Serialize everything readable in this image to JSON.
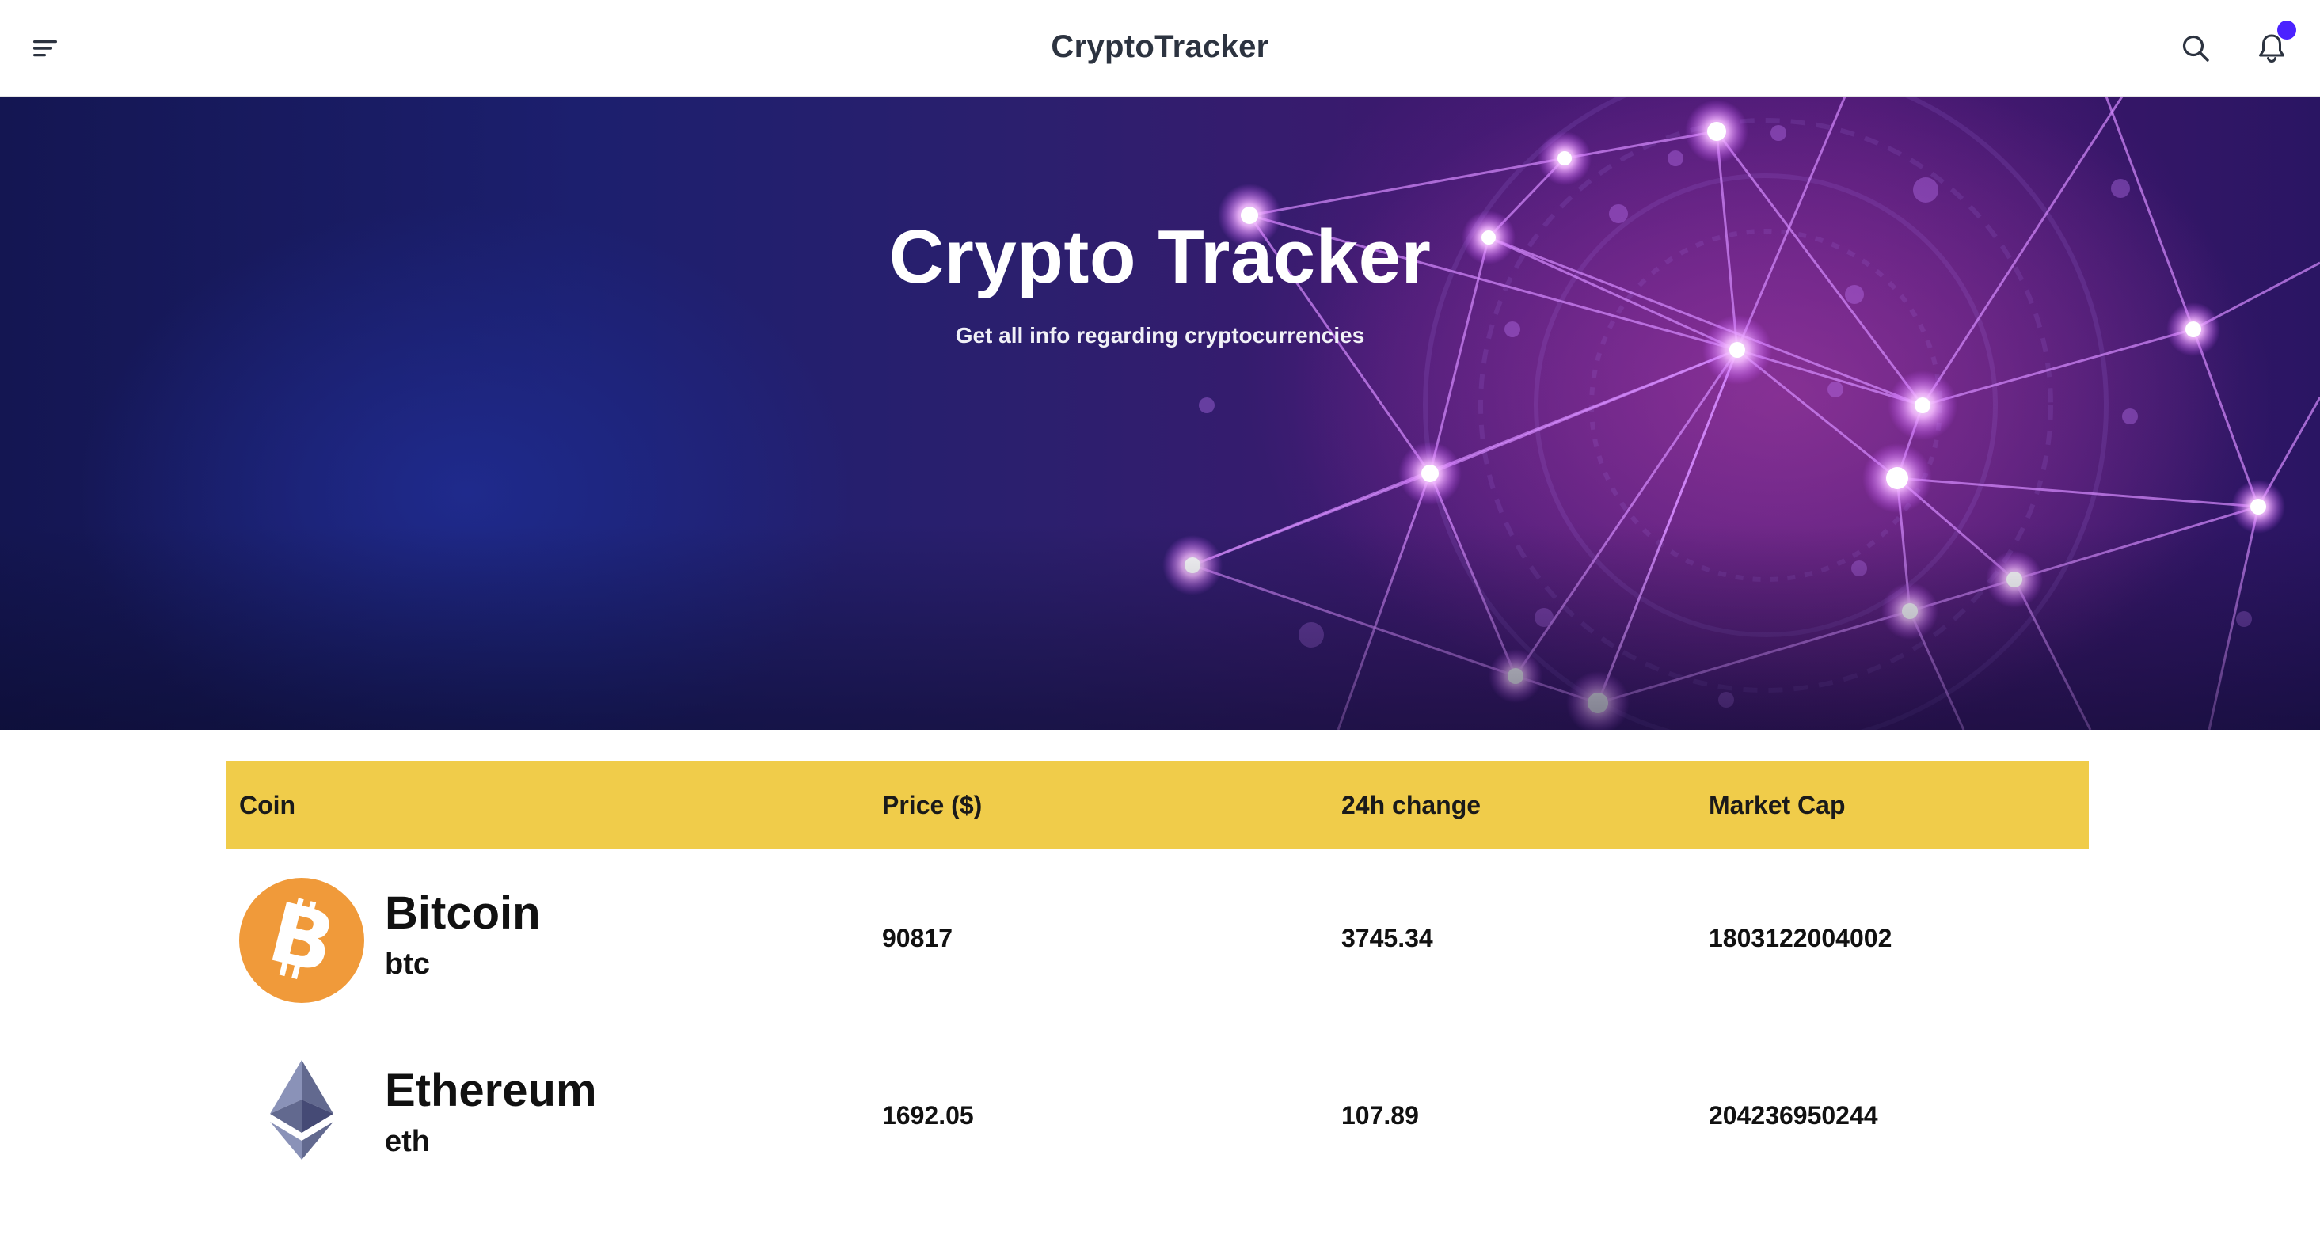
{
  "app": {
    "brand": "CryptoTracker",
    "notification_dot_color": "#4b22ff"
  },
  "icons": {
    "menu": "menu-icon",
    "search": "search-icon",
    "bell": "bell-icon"
  },
  "hero": {
    "title": "Crypto Tracker",
    "subtitle": "Get all info regarding cryptocurrencies"
  },
  "table": {
    "header_color": "#f0cc4a",
    "columns": [
      "Coin",
      "Price ($)",
      "24h change",
      "Market Cap"
    ],
    "rows": [
      {
        "name": "Bitcoin",
        "symbol": "btc",
        "icon": "bitcoin-icon",
        "icon_color": "#f09a3a",
        "price": "90817",
        "change_24h": "3745.34",
        "market_cap": "1803122004002"
      },
      {
        "name": "Ethereum",
        "symbol": "eth",
        "icon": "ethereum-icon",
        "icon_color": "#5f6aa3",
        "price": "1692.05",
        "change_24h": "107.89",
        "market_cap": "204236950244"
      }
    ]
  }
}
